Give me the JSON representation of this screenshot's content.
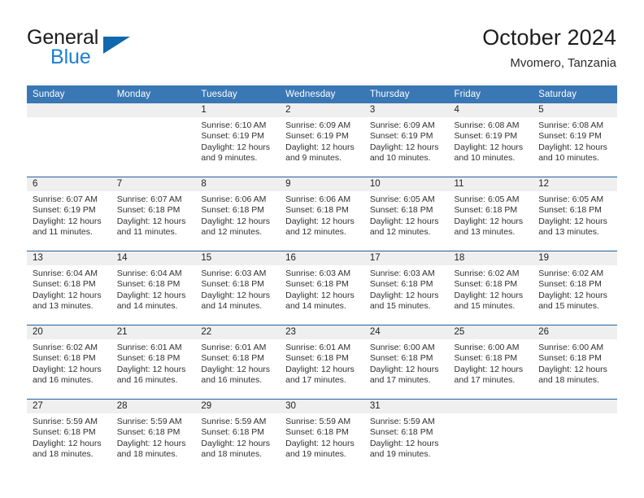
{
  "brand": {
    "word_one": "General",
    "word_two": "Blue",
    "flag_icon": "triangle-flag-icon",
    "colors": {
      "general": "#1b1b1b",
      "blue": "#1b7fd4",
      "flag": "#1268ad"
    }
  },
  "header": {
    "title": "October 2024",
    "subtitle": "Mvomero, Tanzania"
  },
  "theme": {
    "header_blue": "#3a77b5",
    "row_divider_blue": "#1f5fa0",
    "daynum_band_gray": "#efefef",
    "text": "#303030"
  },
  "calendar": {
    "weekdays": [
      "Sunday",
      "Monday",
      "Tuesday",
      "Wednesday",
      "Thursday",
      "Friday",
      "Saturday"
    ],
    "weeks": [
      [
        {
          "day": "",
          "empty": true,
          "sunrise": "",
          "sunset": "",
          "daylight_1": "",
          "daylight_2": ""
        },
        {
          "day": "",
          "empty": true,
          "sunrise": "",
          "sunset": "",
          "daylight_1": "",
          "daylight_2": ""
        },
        {
          "day": "1",
          "empty": false,
          "sunrise": "Sunrise: 6:10 AM",
          "sunset": "Sunset: 6:19 PM",
          "daylight_1": "Daylight: 12 hours",
          "daylight_2": "and 9 minutes."
        },
        {
          "day": "2",
          "empty": false,
          "sunrise": "Sunrise: 6:09 AM",
          "sunset": "Sunset: 6:19 PM",
          "daylight_1": "Daylight: 12 hours",
          "daylight_2": "and 9 minutes."
        },
        {
          "day": "3",
          "empty": false,
          "sunrise": "Sunrise: 6:09 AM",
          "sunset": "Sunset: 6:19 PM",
          "daylight_1": "Daylight: 12 hours",
          "daylight_2": "and 10 minutes."
        },
        {
          "day": "4",
          "empty": false,
          "sunrise": "Sunrise: 6:08 AM",
          "sunset": "Sunset: 6:19 PM",
          "daylight_1": "Daylight: 12 hours",
          "daylight_2": "and 10 minutes."
        },
        {
          "day": "5",
          "empty": false,
          "sunrise": "Sunrise: 6:08 AM",
          "sunset": "Sunset: 6:19 PM",
          "daylight_1": "Daylight: 12 hours",
          "daylight_2": "and 10 minutes."
        }
      ],
      [
        {
          "day": "6",
          "empty": false,
          "sunrise": "Sunrise: 6:07 AM",
          "sunset": "Sunset: 6:19 PM",
          "daylight_1": "Daylight: 12 hours",
          "daylight_2": "and 11 minutes."
        },
        {
          "day": "7",
          "empty": false,
          "sunrise": "Sunrise: 6:07 AM",
          "sunset": "Sunset: 6:18 PM",
          "daylight_1": "Daylight: 12 hours",
          "daylight_2": "and 11 minutes."
        },
        {
          "day": "8",
          "empty": false,
          "sunrise": "Sunrise: 6:06 AM",
          "sunset": "Sunset: 6:18 PM",
          "daylight_1": "Daylight: 12 hours",
          "daylight_2": "and 12 minutes."
        },
        {
          "day": "9",
          "empty": false,
          "sunrise": "Sunrise: 6:06 AM",
          "sunset": "Sunset: 6:18 PM",
          "daylight_1": "Daylight: 12 hours",
          "daylight_2": "and 12 minutes."
        },
        {
          "day": "10",
          "empty": false,
          "sunrise": "Sunrise: 6:05 AM",
          "sunset": "Sunset: 6:18 PM",
          "daylight_1": "Daylight: 12 hours",
          "daylight_2": "and 12 minutes."
        },
        {
          "day": "11",
          "empty": false,
          "sunrise": "Sunrise: 6:05 AM",
          "sunset": "Sunset: 6:18 PM",
          "daylight_1": "Daylight: 12 hours",
          "daylight_2": "and 13 minutes."
        },
        {
          "day": "12",
          "empty": false,
          "sunrise": "Sunrise: 6:05 AM",
          "sunset": "Sunset: 6:18 PM",
          "daylight_1": "Daylight: 12 hours",
          "daylight_2": "and 13 minutes."
        }
      ],
      [
        {
          "day": "13",
          "empty": false,
          "sunrise": "Sunrise: 6:04 AM",
          "sunset": "Sunset: 6:18 PM",
          "daylight_1": "Daylight: 12 hours",
          "daylight_2": "and 13 minutes."
        },
        {
          "day": "14",
          "empty": false,
          "sunrise": "Sunrise: 6:04 AM",
          "sunset": "Sunset: 6:18 PM",
          "daylight_1": "Daylight: 12 hours",
          "daylight_2": "and 14 minutes."
        },
        {
          "day": "15",
          "empty": false,
          "sunrise": "Sunrise: 6:03 AM",
          "sunset": "Sunset: 6:18 PM",
          "daylight_1": "Daylight: 12 hours",
          "daylight_2": "and 14 minutes."
        },
        {
          "day": "16",
          "empty": false,
          "sunrise": "Sunrise: 6:03 AM",
          "sunset": "Sunset: 6:18 PM",
          "daylight_1": "Daylight: 12 hours",
          "daylight_2": "and 14 minutes."
        },
        {
          "day": "17",
          "empty": false,
          "sunrise": "Sunrise: 6:03 AM",
          "sunset": "Sunset: 6:18 PM",
          "daylight_1": "Daylight: 12 hours",
          "daylight_2": "and 15 minutes."
        },
        {
          "day": "18",
          "empty": false,
          "sunrise": "Sunrise: 6:02 AM",
          "sunset": "Sunset: 6:18 PM",
          "daylight_1": "Daylight: 12 hours",
          "daylight_2": "and 15 minutes."
        },
        {
          "day": "19",
          "empty": false,
          "sunrise": "Sunrise: 6:02 AM",
          "sunset": "Sunset: 6:18 PM",
          "daylight_1": "Daylight: 12 hours",
          "daylight_2": "and 15 minutes."
        }
      ],
      [
        {
          "day": "20",
          "empty": false,
          "sunrise": "Sunrise: 6:02 AM",
          "sunset": "Sunset: 6:18 PM",
          "daylight_1": "Daylight: 12 hours",
          "daylight_2": "and 16 minutes."
        },
        {
          "day": "21",
          "empty": false,
          "sunrise": "Sunrise: 6:01 AM",
          "sunset": "Sunset: 6:18 PM",
          "daylight_1": "Daylight: 12 hours",
          "daylight_2": "and 16 minutes."
        },
        {
          "day": "22",
          "empty": false,
          "sunrise": "Sunrise: 6:01 AM",
          "sunset": "Sunset: 6:18 PM",
          "daylight_1": "Daylight: 12 hours",
          "daylight_2": "and 16 minutes."
        },
        {
          "day": "23",
          "empty": false,
          "sunrise": "Sunrise: 6:01 AM",
          "sunset": "Sunset: 6:18 PM",
          "daylight_1": "Daylight: 12 hours",
          "daylight_2": "and 17 minutes."
        },
        {
          "day": "24",
          "empty": false,
          "sunrise": "Sunrise: 6:00 AM",
          "sunset": "Sunset: 6:18 PM",
          "daylight_1": "Daylight: 12 hours",
          "daylight_2": "and 17 minutes."
        },
        {
          "day": "25",
          "empty": false,
          "sunrise": "Sunrise: 6:00 AM",
          "sunset": "Sunset: 6:18 PM",
          "daylight_1": "Daylight: 12 hours",
          "daylight_2": "and 17 minutes."
        },
        {
          "day": "26",
          "empty": false,
          "sunrise": "Sunrise: 6:00 AM",
          "sunset": "Sunset: 6:18 PM",
          "daylight_1": "Daylight: 12 hours",
          "daylight_2": "and 18 minutes."
        }
      ],
      [
        {
          "day": "27",
          "empty": false,
          "sunrise": "Sunrise: 5:59 AM",
          "sunset": "Sunset: 6:18 PM",
          "daylight_1": "Daylight: 12 hours",
          "daylight_2": "and 18 minutes."
        },
        {
          "day": "28",
          "empty": false,
          "sunrise": "Sunrise: 5:59 AM",
          "sunset": "Sunset: 6:18 PM",
          "daylight_1": "Daylight: 12 hours",
          "daylight_2": "and 18 minutes."
        },
        {
          "day": "29",
          "empty": false,
          "sunrise": "Sunrise: 5:59 AM",
          "sunset": "Sunset: 6:18 PM",
          "daylight_1": "Daylight: 12 hours",
          "daylight_2": "and 18 minutes."
        },
        {
          "day": "30",
          "empty": false,
          "sunrise": "Sunrise: 5:59 AM",
          "sunset": "Sunset: 6:18 PM",
          "daylight_1": "Daylight: 12 hours",
          "daylight_2": "and 19 minutes."
        },
        {
          "day": "31",
          "empty": false,
          "sunrise": "Sunrise: 5:59 AM",
          "sunset": "Sunset: 6:18 PM",
          "daylight_1": "Daylight: 12 hours",
          "daylight_2": "and 19 minutes."
        },
        {
          "day": "",
          "empty": true,
          "sunrise": "",
          "sunset": "",
          "daylight_1": "",
          "daylight_2": ""
        },
        {
          "day": "",
          "empty": true,
          "sunrise": "",
          "sunset": "",
          "daylight_1": "",
          "daylight_2": ""
        }
      ]
    ]
  }
}
